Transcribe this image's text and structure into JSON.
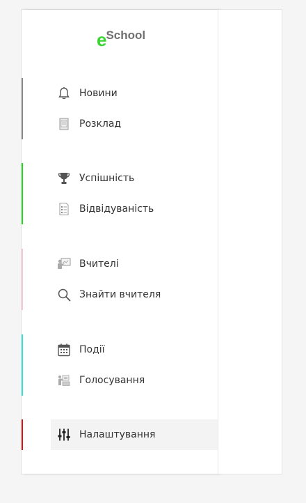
{
  "brand": {
    "prefix": "e",
    "name": "School",
    "accent": "#38d430",
    "text_color": "#6f6f6f"
  },
  "nav_groups": [
    {
      "color": "#888888",
      "items": [
        {
          "label": "Новини",
          "icon": "bell-icon"
        },
        {
          "label": "Розклад",
          "icon": "schedule-sheet-icon"
        }
      ]
    },
    {
      "color": "#22d822",
      "items": [
        {
          "label": "Успішність",
          "icon": "trophy-icon"
        },
        {
          "label": "Відвідуваність",
          "icon": "attendance-sheet-icon"
        }
      ]
    },
    {
      "color": "#f7c6d6",
      "items": [
        {
          "label": "Вчителі",
          "icon": "teacher-board-icon"
        },
        {
          "label": "Знайти вчителя",
          "icon": "search-icon"
        }
      ]
    },
    {
      "color": "#33e0e0",
      "items": [
        {
          "label": "Події",
          "icon": "calendar-icon"
        },
        {
          "label": "Голосування",
          "icon": "voting-icon"
        }
      ]
    },
    {
      "color": "#dd1111",
      "items": [
        {
          "label": "Налаштування",
          "icon": "sliders-icon",
          "active": true
        }
      ]
    }
  ]
}
